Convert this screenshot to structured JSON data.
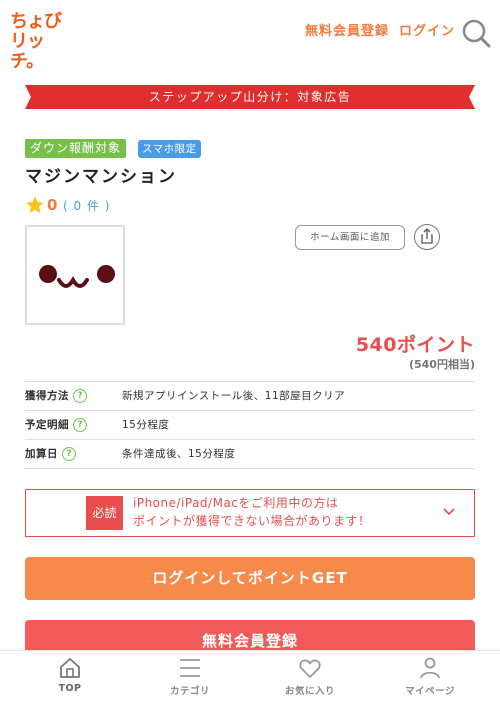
{
  "header": {
    "logo_line1": "ちょび",
    "logo_line2": "リッチ。",
    "register_link": "無料会員登録",
    "login_link": "ログイン",
    "search_icon": "search-icon"
  },
  "banner": {
    "text": "ステップアップ山分け：対象広告"
  },
  "tags": {
    "download": "ダウン報酬対象",
    "smartphone": "スマホ限定"
  },
  "app": {
    "title": "マジンマンション",
    "rating_value": "0",
    "rating_count": "( 0 件 )",
    "home_screen_button": "ホーム画面に追加",
    "share_icon": "share-icon"
  },
  "points": {
    "main": "540ポイント",
    "sub": "(540円相当)"
  },
  "info_rows": [
    {
      "label": "獲得方法",
      "value": "新規アプリインストール後、11部屋目クリア"
    },
    {
      "label": "予定明細",
      "value": "15分程度"
    },
    {
      "label": "加算日",
      "value": "条件達成後、15分程度"
    }
  ],
  "notice": {
    "badge": "必読",
    "line1": "iPhone/iPad/Macをご利用中の方は",
    "line2": "ポイントが獲得できない場合があります！"
  },
  "buttons": {
    "login_get": "ログインしてポイントGET",
    "register": "無料会員登録"
  },
  "tabbar": [
    {
      "label": "TOP",
      "icon": "home-icon"
    },
    {
      "label": "カテゴリ",
      "icon": "menu-icon"
    },
    {
      "label": "お気に入り",
      "icon": "heart-icon"
    },
    {
      "label": "マイページ",
      "icon": "user-icon"
    }
  ],
  "colors": {
    "brand_orange": "#f25c19",
    "accent_red": "#e94d4d",
    "green": "#76c04a",
    "blue": "#4a9ce8"
  }
}
